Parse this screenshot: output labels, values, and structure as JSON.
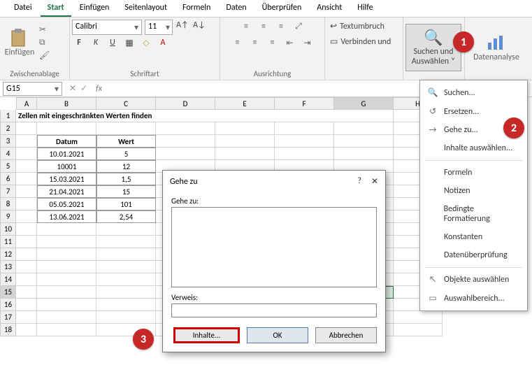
{
  "menu": {
    "datei": "Datei",
    "start": "Start",
    "einfuegen": "Einfügen",
    "seitenlayout": "Seitenlayout",
    "formeln": "Formeln",
    "daten": "Daten",
    "ueberpruefen": "Überprüfen",
    "ansicht": "Ansicht",
    "hilfe": "Hilfe"
  },
  "ribbon": {
    "clipboard_label": "Zwischenablage",
    "clipboard_paste": "Einfügen",
    "font_label": "Schriftart",
    "font_name": "Calibri",
    "font_size": "11",
    "align_label": "Ausrichtung",
    "wrap": "Textumbruch",
    "merge": "Verbinden und",
    "findsel_top": "Suchen und",
    "findsel_bot": "Auswählen",
    "analysis": "Datenanalyse"
  },
  "namebox": "G15",
  "dropdown": {
    "suchen": "Suchen...",
    "ersetzen": "Ersetzen...",
    "geheZu": "Gehe zu...",
    "inhalte": "Inhalte auswählen...",
    "formeln": "Formeln",
    "notizen": "Notizen",
    "bedingte": "Bedingte Formatierung",
    "konstanten": "Konstanten",
    "datenueber": "Datenüberprüfung",
    "objekte": "Objekte auswählen",
    "auswahlbereich": "Auswahlbereich..."
  },
  "dialog": {
    "title": "Gehe zu",
    "listlabel": "Gehe zu:",
    "reflabel": "Verweis:",
    "inhalte": "Inhalte...",
    "ok": "OK",
    "abbrechen": "Abbrechen"
  },
  "circles": {
    "c1": "1",
    "c2": "2",
    "c3": "3"
  },
  "sheet": {
    "cols": [
      "A",
      "B",
      "C",
      "D",
      "E",
      "F",
      "G",
      "H"
    ],
    "title": "Zellen mit eingeschränkten Werten finden",
    "headers": {
      "datum": "Datum",
      "wert": "Wert"
    },
    "rows": [
      {
        "d": "10.01.2021",
        "w": "5"
      },
      {
        "d": "10001",
        "w": "12"
      },
      {
        "d": "15.03.2021",
        "w": "1,5"
      },
      {
        "d": "21.04.2021",
        "w": "15"
      },
      {
        "d": "05.05.2021",
        "w": "101"
      },
      {
        "d": "13.06.2021",
        "w": "2,54"
      }
    ]
  }
}
